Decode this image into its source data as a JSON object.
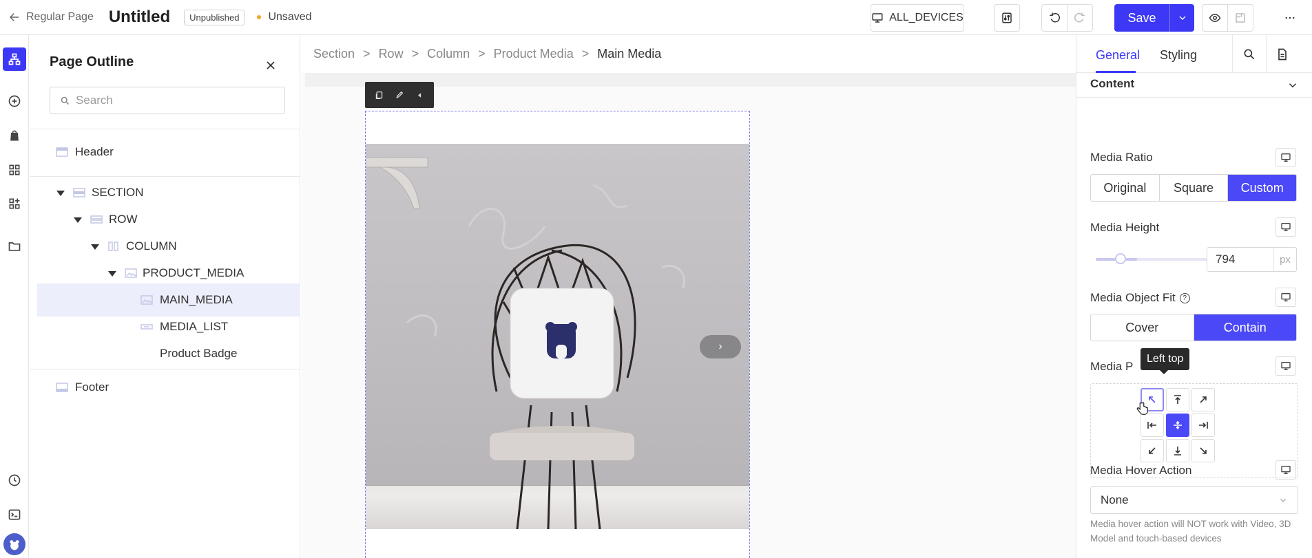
{
  "header": {
    "back_label": "Regular Page",
    "title": "Untitled",
    "publish_status": "Unpublished",
    "save_status": "Unsaved",
    "devices_label": "ALL_DEVICES",
    "save_label": "Save"
  },
  "outline": {
    "title": "Page Outline",
    "search_placeholder": "Search",
    "items": [
      {
        "label": "Header"
      },
      {
        "label": "SECTION"
      },
      {
        "label": "ROW"
      },
      {
        "label": "COLUMN"
      },
      {
        "label": "PRODUCT_MEDIA"
      },
      {
        "label": "MAIN_MEDIA"
      },
      {
        "label": "MEDIA_LIST"
      },
      {
        "label": "Product Badge"
      },
      {
        "label": "Footer"
      }
    ]
  },
  "breadcrumb": [
    "Section",
    "Row",
    "Column",
    "Product Media",
    "Main Media"
  ],
  "panel": {
    "tabs": [
      "General",
      "Styling"
    ],
    "section_title": "Content",
    "media_ratio": {
      "label": "Media Ratio",
      "options": [
        "Original",
        "Square",
        "Custom"
      ],
      "selected": "Custom"
    },
    "media_height": {
      "label": "Media Height",
      "value": "794",
      "unit": "px"
    },
    "object_fit": {
      "label": "Media Object Fit",
      "options": [
        "Cover",
        "Contain"
      ],
      "selected": "Contain"
    },
    "media_position": {
      "label": "Media P",
      "tooltip": "Left top"
    },
    "hover_action": {
      "label": "Media Hover Action",
      "value": "None",
      "note": "Media hover action will NOT work with Video, 3D Model and touch-based devices"
    }
  },
  "colors": {
    "accent": "#3c38f5",
    "selected_row": "#eceefc"
  }
}
